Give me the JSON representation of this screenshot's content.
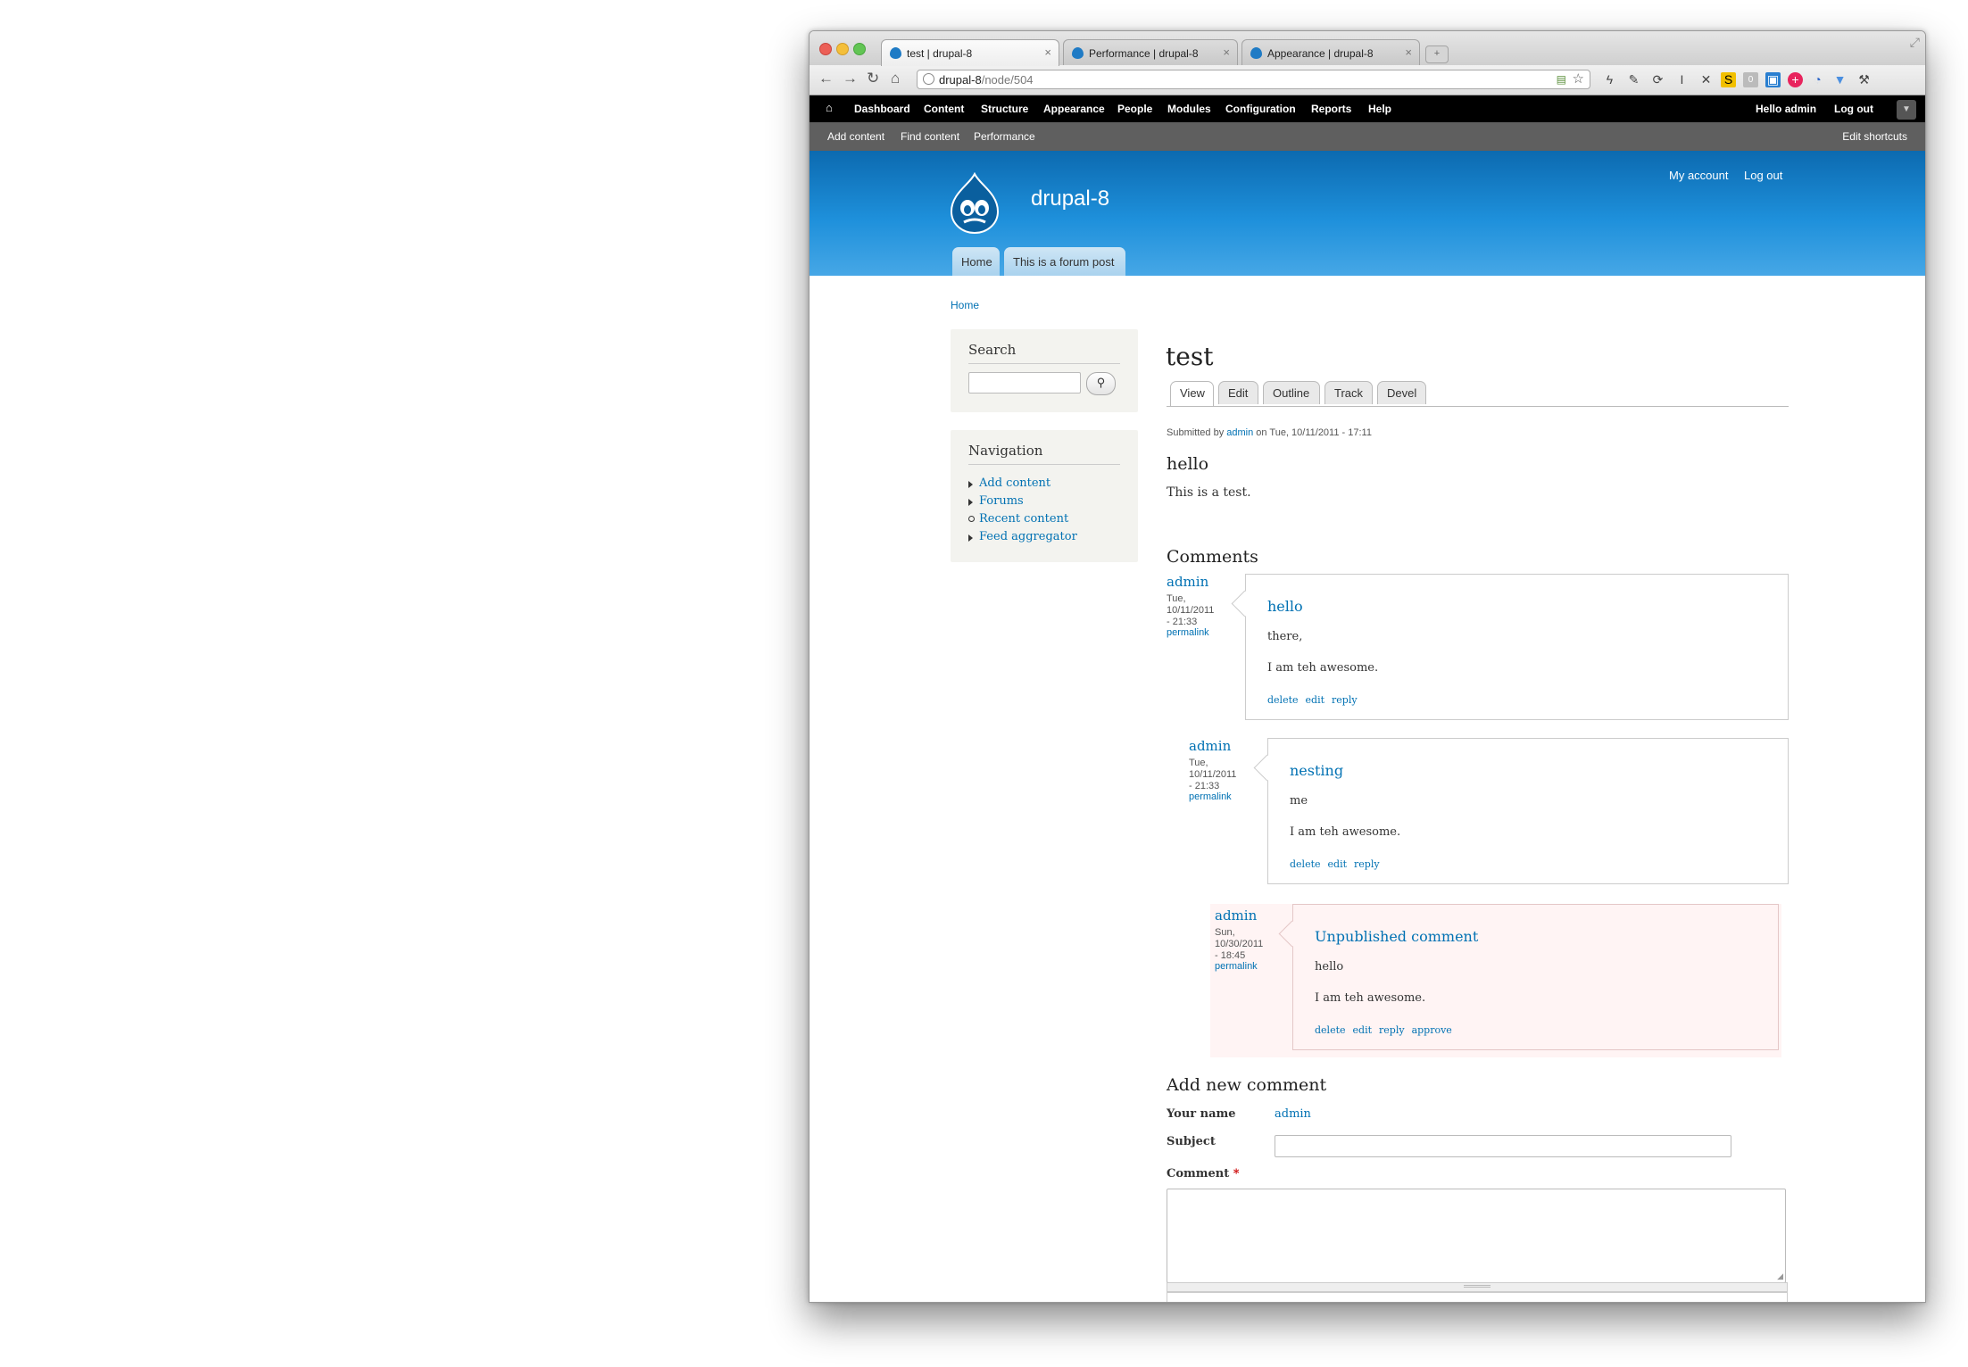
{
  "browser": {
    "tabs": [
      {
        "title": "test | drupal-8"
      },
      {
        "title": "Performance | drupal-8"
      },
      {
        "title": "Appearance | drupal-8"
      }
    ],
    "url_host": "drupal-8",
    "url_path": "/node/504"
  },
  "admin_toolbar": {
    "items": [
      "Dashboard",
      "Content",
      "Structure",
      "Appearance",
      "People",
      "Modules",
      "Configuration",
      "Reports",
      "Help"
    ],
    "hello": "Hello",
    "user": "admin",
    "logout": "Log out"
  },
  "shortcuts": {
    "items": [
      "Add content",
      "Find content",
      "Performance"
    ],
    "edit": "Edit shortcuts"
  },
  "header": {
    "site_name": "drupal-8",
    "my_account": "My account",
    "logout": "Log out",
    "primary_tabs": [
      "Home",
      "This is a forum post"
    ]
  },
  "breadcrumb": "Home",
  "sidebar": {
    "search_title": "Search",
    "navigation_title": "Navigation",
    "nav_items": [
      "Add content",
      "Forums",
      "Recent content",
      "Feed aggregator"
    ]
  },
  "node": {
    "title": "test",
    "local_tabs": [
      "View",
      "Edit",
      "Outline",
      "Track",
      "Devel"
    ],
    "submitted_prefix": "Submitted by",
    "submitted_author": "admin",
    "submitted_suffix": "on Tue, 10/11/2011 - 17:11",
    "body_heading": "hello",
    "body_text": "This is a test."
  },
  "comments": {
    "heading": "Comments",
    "permalink": "permalink",
    "items": [
      {
        "author": "admin",
        "date_line1": "Tue,",
        "date_line2": "10/11/2011",
        "date_line3": "- 21:33",
        "subject": "hello",
        "p1": "there,",
        "p2": "I am teh awesome.",
        "links": [
          "delete",
          "edit",
          "reply"
        ]
      },
      {
        "author": "admin",
        "date_line1": "Tue,",
        "date_line2": "10/11/2011",
        "date_line3": "- 21:33",
        "subject": "nesting",
        "p1": "me",
        "p2": "I am teh awesome.",
        "links": [
          "delete",
          "edit",
          "reply"
        ]
      },
      {
        "author": "admin",
        "date_line1": "Sun,",
        "date_line2": "10/30/2011",
        "date_line3": "- 18:45",
        "subject": "Unpublished comment",
        "p1": "hello",
        "p2": "I am teh awesome.",
        "links": [
          "delete",
          "edit",
          "reply",
          "approve"
        ]
      }
    ]
  },
  "comment_form": {
    "heading": "Add new comment",
    "name_label": "Your name",
    "name_value": "admin",
    "subject_label": "Subject",
    "comment_label": "Comment",
    "required_mark": "*"
  },
  "colors": {
    "link": "#0071b3",
    "header_blue": "#1e90db",
    "unpublished_bg": "#fff4f4"
  }
}
